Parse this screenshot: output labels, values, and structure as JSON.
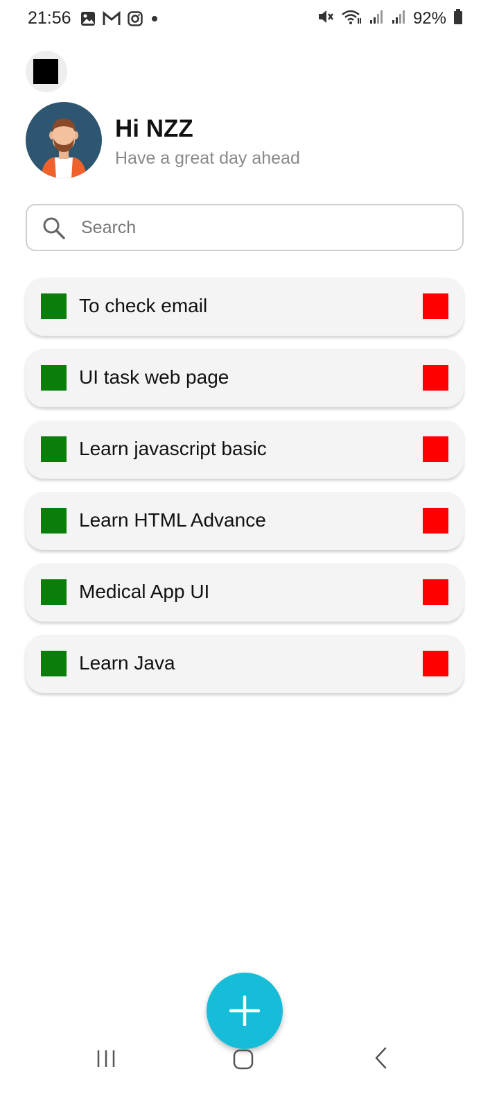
{
  "status_bar": {
    "time": "21:56",
    "left_icons": [
      "gallery-icon",
      "gmail-icon",
      "instagram-icon",
      "dot-icon"
    ],
    "right_icons": [
      "mute-icon",
      "wifi-icon",
      "signal-icon",
      "signal-icon",
      "battery-icon"
    ],
    "battery": "92%"
  },
  "header": {
    "greeting": "Hi NZZ",
    "subtitle": "Have a great day ahead"
  },
  "search": {
    "placeholder": "Search",
    "value": ""
  },
  "tasks": [
    {
      "label": "To check email"
    },
    {
      "label": "UI task web page"
    },
    {
      "label": "Learn javascript basic"
    },
    {
      "label": "Learn HTML Advance"
    },
    {
      "label": "Medical App UI"
    },
    {
      "label": "Learn Java"
    }
  ],
  "colors": {
    "check": "#0a7d0a",
    "delete": "#ff0000",
    "fab": "#17bcd8",
    "avatar_bg": "#2f5670"
  },
  "nav": [
    "recents-icon",
    "home-icon",
    "back-icon"
  ]
}
